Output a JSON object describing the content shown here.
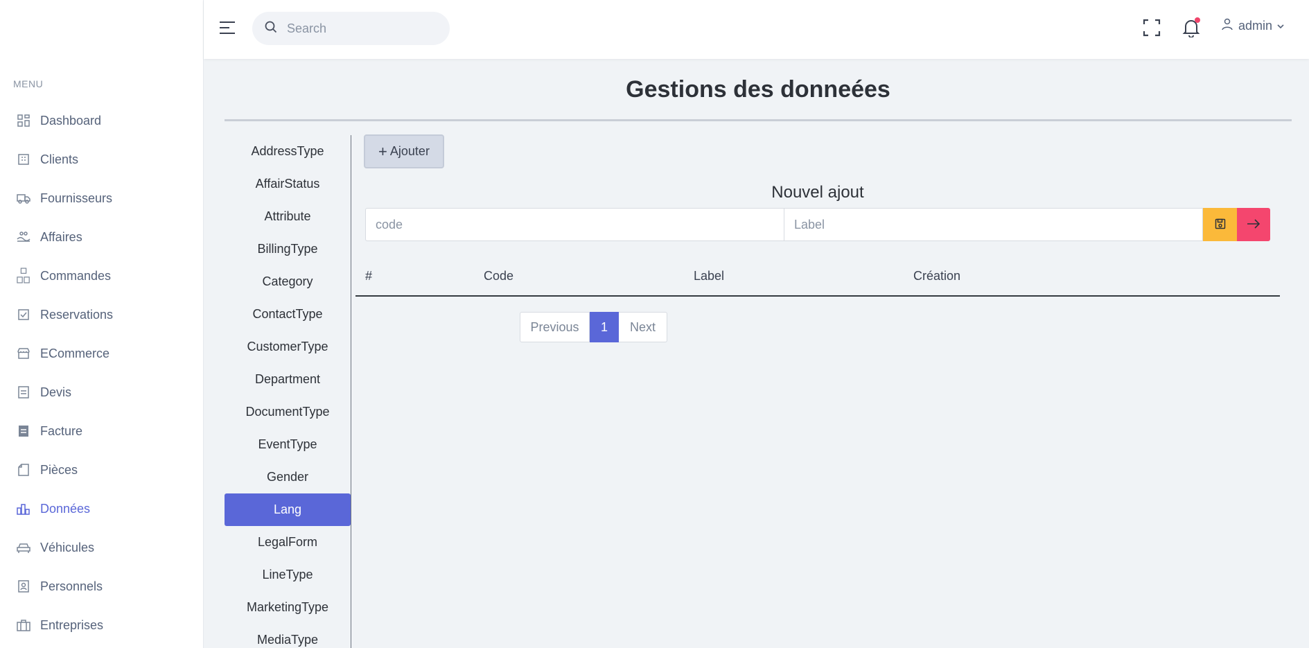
{
  "topbar": {
    "search_placeholder": "Search",
    "user_name": "admin"
  },
  "sidebar": {
    "menu_title": "MENU",
    "active": "Données",
    "items": [
      {
        "label": "Dashboard",
        "icon": "grid-icon"
      },
      {
        "label": "Clients",
        "icon": "building-icon"
      },
      {
        "label": "Fournisseurs",
        "icon": "truck-icon"
      },
      {
        "label": "Affaires",
        "icon": "handshake-icon"
      },
      {
        "label": "Commandes",
        "icon": "boxes-icon"
      },
      {
        "label": "Reservations",
        "icon": "checkbox-icon"
      },
      {
        "label": "ECommerce",
        "icon": "store-icon"
      },
      {
        "label": "Devis",
        "icon": "document-icon"
      },
      {
        "label": "Facture",
        "icon": "invoice-icon"
      },
      {
        "label": "Pièces",
        "icon": "file-icon"
      },
      {
        "label": "Données",
        "icon": "chart-icon"
      },
      {
        "label": "Véhicules",
        "icon": "car-icon"
      },
      {
        "label": "Personnels",
        "icon": "id-card-icon"
      },
      {
        "label": "Entreprises",
        "icon": "briefcase-icon"
      }
    ]
  },
  "main": {
    "title": "Gestions des donneées",
    "types": [
      "AddressType",
      "AffairStatus",
      "Attribute",
      "BillingType",
      "Category",
      "ContactType",
      "CustomerType",
      "Department",
      "DocumentType",
      "EventType",
      "Gender",
      "Lang",
      "LegalForm",
      "LineType",
      "MarketingType",
      "MediaType"
    ],
    "active_type": "Lang",
    "add_button": "Ajouter",
    "form_title": "Nouvel ajout",
    "code_placeholder": "code",
    "label_placeholder": "Label",
    "table": {
      "headers": [
        "#",
        "Code",
        "Label",
        "Création"
      ]
    },
    "pagination": {
      "previous": "Previous",
      "current": "1",
      "next": "Next"
    }
  },
  "colors": {
    "accent": "#5a67d8",
    "save": "#fbb93a",
    "go": "#f4466e",
    "notification": "#f0446a"
  }
}
